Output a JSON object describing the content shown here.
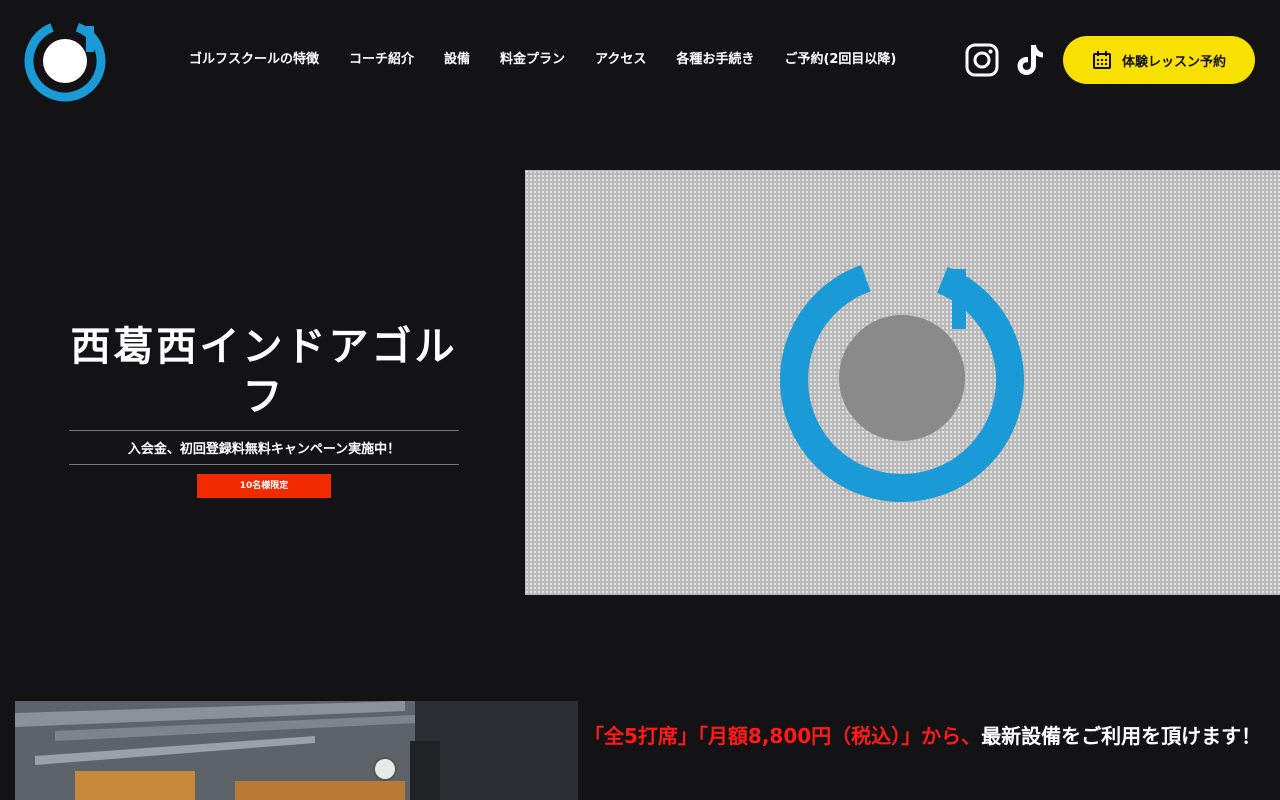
{
  "nav": {
    "items": [
      {
        "label": "ゴルフスクールの特徴"
      },
      {
        "label": "コーチ紹介"
      },
      {
        "label": "設備"
      },
      {
        "label": "料金プラン"
      },
      {
        "label": "アクセス"
      },
      {
        "label": "各種お手続き"
      },
      {
        "label": "ご予約(2回目以降)"
      }
    ]
  },
  "social": {
    "instagram_icon": "instagram-icon",
    "tiktok_icon": "tiktok-icon"
  },
  "cta": {
    "label": "体験レッスン予約",
    "icon": "calendar-icon"
  },
  "hero": {
    "title": "西葛西インドアゴルフ",
    "subtitle": "入会金、初回登録料無料キャンペーン実施中！",
    "badge": "10名様限定"
  },
  "promo": {
    "highlight": "「全5打席」「月額8,800円（税込）」から、",
    "text": "最新設備をご利用を頂けます！"
  },
  "colors": {
    "brand_blue": "#1a9ad6",
    "cta_yellow": "#f8e100",
    "badge_red": "#f12a00",
    "promo_red": "#ff1a1a",
    "background": "#131315"
  }
}
